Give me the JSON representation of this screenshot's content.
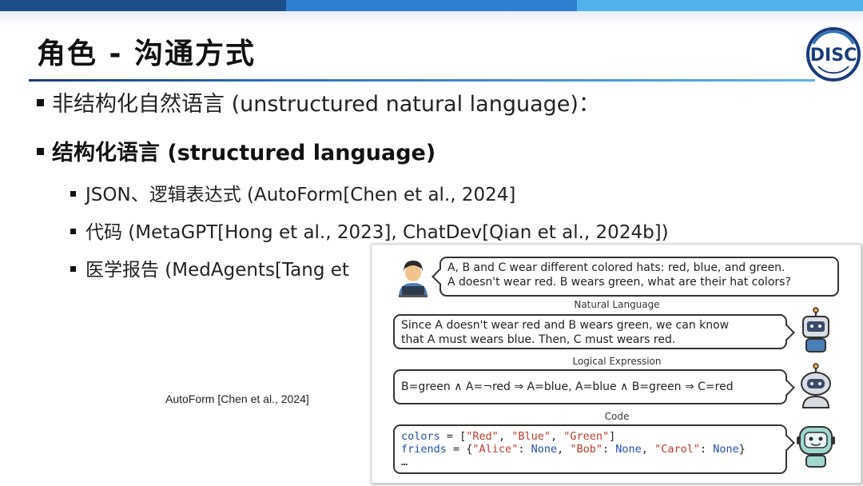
{
  "header": {
    "title": "角色 - 沟通方式",
    "colors": {
      "bar_dark": "#1f4e8c",
      "bar_mid": "#2f7fd1",
      "bar_light": "#4fb3ea"
    },
    "logo_text": "DISC"
  },
  "bullets": [
    {
      "text": "非结构化自然语言 (unstructured natural language)："
    },
    {
      "text": "结构化语言 (structured language)"
    }
  ],
  "sub_bullets": [
    {
      "text": "JSON、逻辑表达式 (AutoForm[Chen et al., 2024]"
    },
    {
      "text": "代码 (MetaGPT[Hong et al., 2023], ChatDev[Qian et al., 2024b])"
    },
    {
      "text": "医学报告 (MedAgents[Tang et"
    }
  ],
  "caption": "AutoForm [Chen et al., 2024]",
  "figure": {
    "question_line1": "A, B and C wear different colored hats: red, blue, and green.",
    "question_line2": "A doesn't wear red. B wears green, what are their hat colors?",
    "label_natural": "Natural Language",
    "answer_natural_line1": "Since A doesn't wear red and B wears green, we can know",
    "answer_natural_line2": "that A must wears blue. Then, C must wears red.",
    "label_logical": "Logical Expression",
    "answer_logical": "B=green ∧ A=¬red ⇒ A=blue,   A=blue ∧ B=green ⇒ C=red",
    "label_code": "Code",
    "code_line1_var": "colors",
    "code_line1_eq": " = [",
    "code_line1_s1": "\"Red\"",
    "code_line1_s2": "\"Blue\"",
    "code_line1_s3": "\"Green\"",
    "code_line2_var": "friends",
    "code_line2_eq": " = {",
    "code_line2_k1": "\"Alice\"",
    "code_line2_k2": "\"Bob\"",
    "code_line2_k3": "\"Carol\"",
    "code_none": "None",
    "code_line3": "…"
  }
}
